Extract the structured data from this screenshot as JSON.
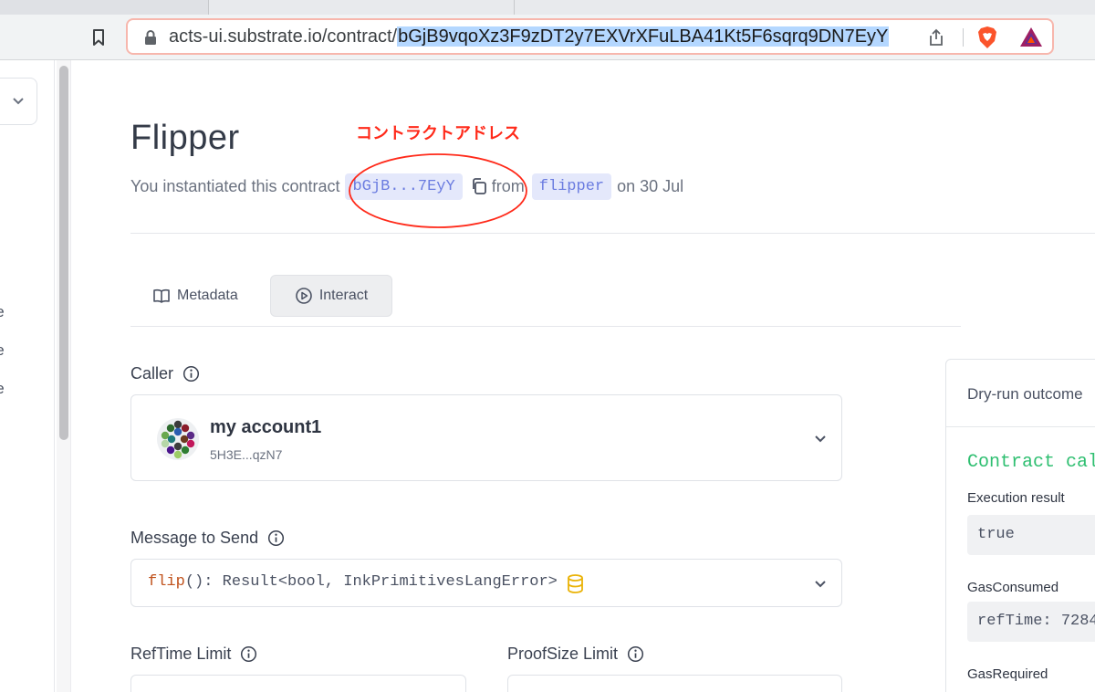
{
  "browser": {
    "url_prefix": "acts-ui.substrate.io/contract/",
    "url_selected": "bGjB9vqoXz3F9zDT2y7EXVrXFuLBA41Kt5F6sqrq9DN7EyY"
  },
  "sidebar": {
    "items": [
      "ble",
      "ble",
      "ble"
    ]
  },
  "page": {
    "title": "Flipper",
    "annotation": "コントラクトアドレス",
    "subtitle_prefix": "You instantiated this contract",
    "address_short": "bGjB...7EyY",
    "from_text": "from",
    "code_name": "flipper",
    "date_text": "on 30 Jul"
  },
  "tabs": {
    "metadata_label": "Metadata",
    "interact_label": "Interact"
  },
  "form": {
    "caller_label": "Caller",
    "account_name": "my account1",
    "account_address": "5H3E...qzN7",
    "message_label": "Message to Send",
    "message_fn": "flip",
    "message_rest": "(): Result<bool, InkPrimitivesLangError>",
    "reftime_label": "RefTime Limit",
    "proofsize_label": "ProofSize Limit"
  },
  "dry_run": {
    "title": "Dry-run outcome",
    "heading": "Contract call",
    "execution_label": "Execution result",
    "execution_value": "true",
    "gas_consumed_label": "GasConsumed",
    "gas_consumed_value": "refTime: 7284",
    "gas_required_label": "GasRequired"
  },
  "colors": {
    "annotation": "#ff2a1a",
    "chip_text": "#6b7ce0",
    "chip_bg": "#e4e8fb",
    "success": "#2fbf71",
    "url_selection": "#b4d7ff"
  }
}
